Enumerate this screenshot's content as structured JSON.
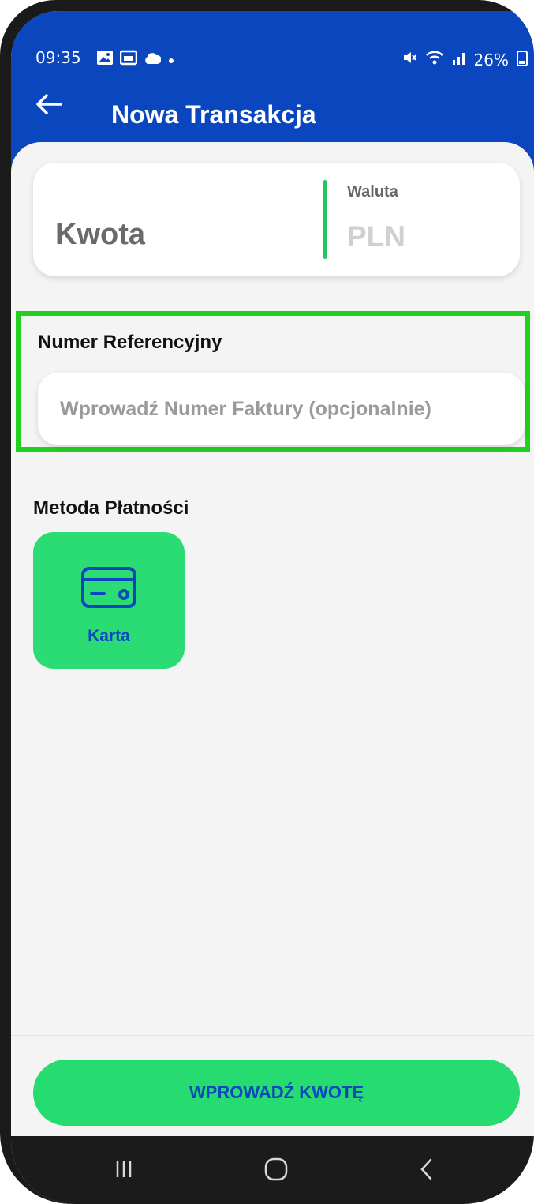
{
  "status_bar": {
    "time": "09:35",
    "battery": "26%",
    "left_icons": [
      "image-icon",
      "calendar-card-icon",
      "cloud-icon",
      "dot-icon"
    ],
    "right_icons": [
      "mute-icon",
      "wifi-icon",
      "signal-icon",
      "battery-icon"
    ]
  },
  "header": {
    "title": "Nowa Transakcja",
    "back_icon": "arrow-left-icon"
  },
  "amount": {
    "label": "Kwota",
    "currency_label": "Waluta",
    "currency_value": "PLN"
  },
  "reference": {
    "label": "Numer Referencyjny",
    "placeholder": "Wprowadź Numer Faktury (opcjonalnie)",
    "value": ""
  },
  "payment": {
    "title": "Metoda Płatności",
    "methods": [
      {
        "label": "Karta",
        "icon": "credit-card-icon"
      }
    ]
  },
  "cta": {
    "label": "WPROWADŹ KWOTĘ"
  },
  "nav": {
    "recents_icon": "recents-icon",
    "home_icon": "home-icon",
    "back_icon": "back-chevron-icon"
  },
  "colors": {
    "primary": "#0a47bf",
    "accent_green": "#2bdc74",
    "highlight": "#22d022",
    "background": "#f4f4f4"
  }
}
